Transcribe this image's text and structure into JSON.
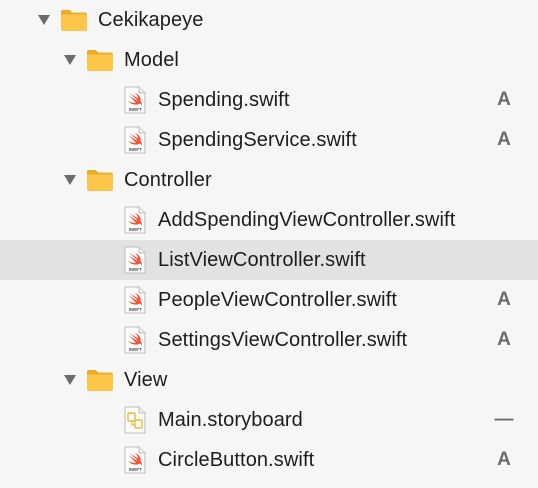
{
  "navigator": {
    "items": [
      {
        "kind": "folder",
        "level": 0,
        "label": "Cekikapeye",
        "expanded": true,
        "status": ""
      },
      {
        "kind": "folder",
        "level": 1,
        "label": "Model",
        "expanded": true,
        "status": ""
      },
      {
        "kind": "swift",
        "level": 2,
        "label": "Spending.swift",
        "status": "A"
      },
      {
        "kind": "swift",
        "level": 2,
        "label": "SpendingService.swift",
        "status": "A"
      },
      {
        "kind": "folder",
        "level": 1,
        "label": "Controller",
        "expanded": true,
        "status": ""
      },
      {
        "kind": "swift",
        "level": 2,
        "label": "AddSpendingViewController.swift",
        "status": ""
      },
      {
        "kind": "swift",
        "level": 2,
        "label": "ListViewController.swift",
        "status": "",
        "selected": true
      },
      {
        "kind": "swift",
        "level": 2,
        "label": "PeopleViewController.swift",
        "status": "A"
      },
      {
        "kind": "swift",
        "level": 2,
        "label": "SettingsViewController.swift",
        "status": "A"
      },
      {
        "kind": "folder",
        "level": 1,
        "label": "View",
        "expanded": true,
        "status": ""
      },
      {
        "kind": "storyboard",
        "level": 2,
        "label": "Main.storyboard",
        "status": "—"
      },
      {
        "kind": "swift",
        "level": 2,
        "label": "CircleButton.swift",
        "status": "A"
      }
    ]
  },
  "icons": {
    "swift_caption": "SWIFT",
    "swift_color": "#f05138",
    "folder_color": "#fbc64a",
    "storyboard_color": "#e8b93a",
    "selected_row_color": "#e2e2e2"
  }
}
